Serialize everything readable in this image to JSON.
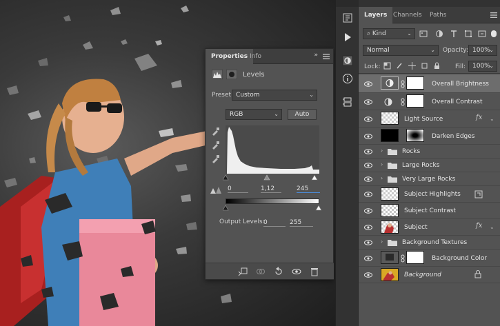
{
  "properties_panel": {
    "tabs": [
      "Properties",
      "Info"
    ],
    "collapse_label": "»",
    "adjustment_title": "Levels",
    "preset_label": "Preset:",
    "preset_value": "Custom",
    "channel_value": "RGB",
    "auto_label": "Auto",
    "input_levels": {
      "black": "0",
      "mid": "1,12",
      "white": "245"
    },
    "output_label": "Output Levels:",
    "output_levels": {
      "black": "0",
      "white": "255"
    }
  },
  "layers_panel": {
    "tabs": [
      "Layers",
      "Channels",
      "Paths"
    ],
    "filter_label": "Kind",
    "blend_mode": "Normal",
    "opacity_label": "Opacity:",
    "opacity_value": "100%",
    "lock_label": "Lock:",
    "fill_label": "Fill:",
    "fill_value": "100%",
    "layers": [
      {
        "name": "Overall Brightness",
        "kind": "adjustment",
        "selected": true
      },
      {
        "name": "Overall Contrast",
        "kind": "adjustment"
      },
      {
        "name": "Light Source",
        "kind": "layer",
        "fx": true
      },
      {
        "name": "Darken Edges",
        "kind": "masked"
      },
      {
        "name": "Rocks",
        "kind": "group"
      },
      {
        "name": "Large Rocks",
        "kind": "group"
      },
      {
        "name": "Very Large Rocks",
        "kind": "group"
      },
      {
        "name": "Subject Highlights",
        "kind": "layer"
      },
      {
        "name": "Subject Contrast",
        "kind": "layer"
      },
      {
        "name": "Subject",
        "kind": "layer",
        "fx": true
      },
      {
        "name": "Background Textures",
        "kind": "group"
      },
      {
        "name": "Background Color",
        "kind": "fill"
      },
      {
        "name": "Background",
        "kind": "background",
        "locked": true
      }
    ]
  },
  "colors": {
    "panel": "#535353",
    "dark": "#323232",
    "selected": "#6d6d6d",
    "accent": "#4b8cd8"
  }
}
